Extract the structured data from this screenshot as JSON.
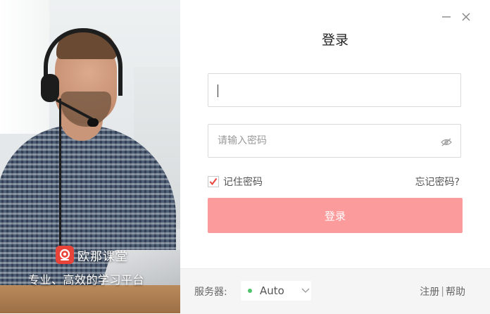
{
  "window": {
    "title": "登录"
  },
  "brand": {
    "name": "欧那课堂",
    "slogan": "专业、高效的学习平台",
    "accent": "#e8443a"
  },
  "form": {
    "username": {
      "value": "",
      "placeholder": ""
    },
    "password": {
      "value": "",
      "placeholder": "请输入密码"
    },
    "remember": {
      "label": "记住密码",
      "checked": true
    },
    "forgot_label": "忘记密码?",
    "login_label": "登录",
    "login_color": "#fc9b9b"
  },
  "footer": {
    "server_label": "服务器:",
    "server_value": "Auto",
    "server_status_color": "#4fc26a",
    "register_label": "注册",
    "separator": "|",
    "help_label": "帮助"
  },
  "icons": [
    "minimize-icon",
    "close-icon",
    "eye-hidden-icon",
    "checkmark-icon",
    "chevron-down-icon",
    "brand-logo-icon"
  ]
}
